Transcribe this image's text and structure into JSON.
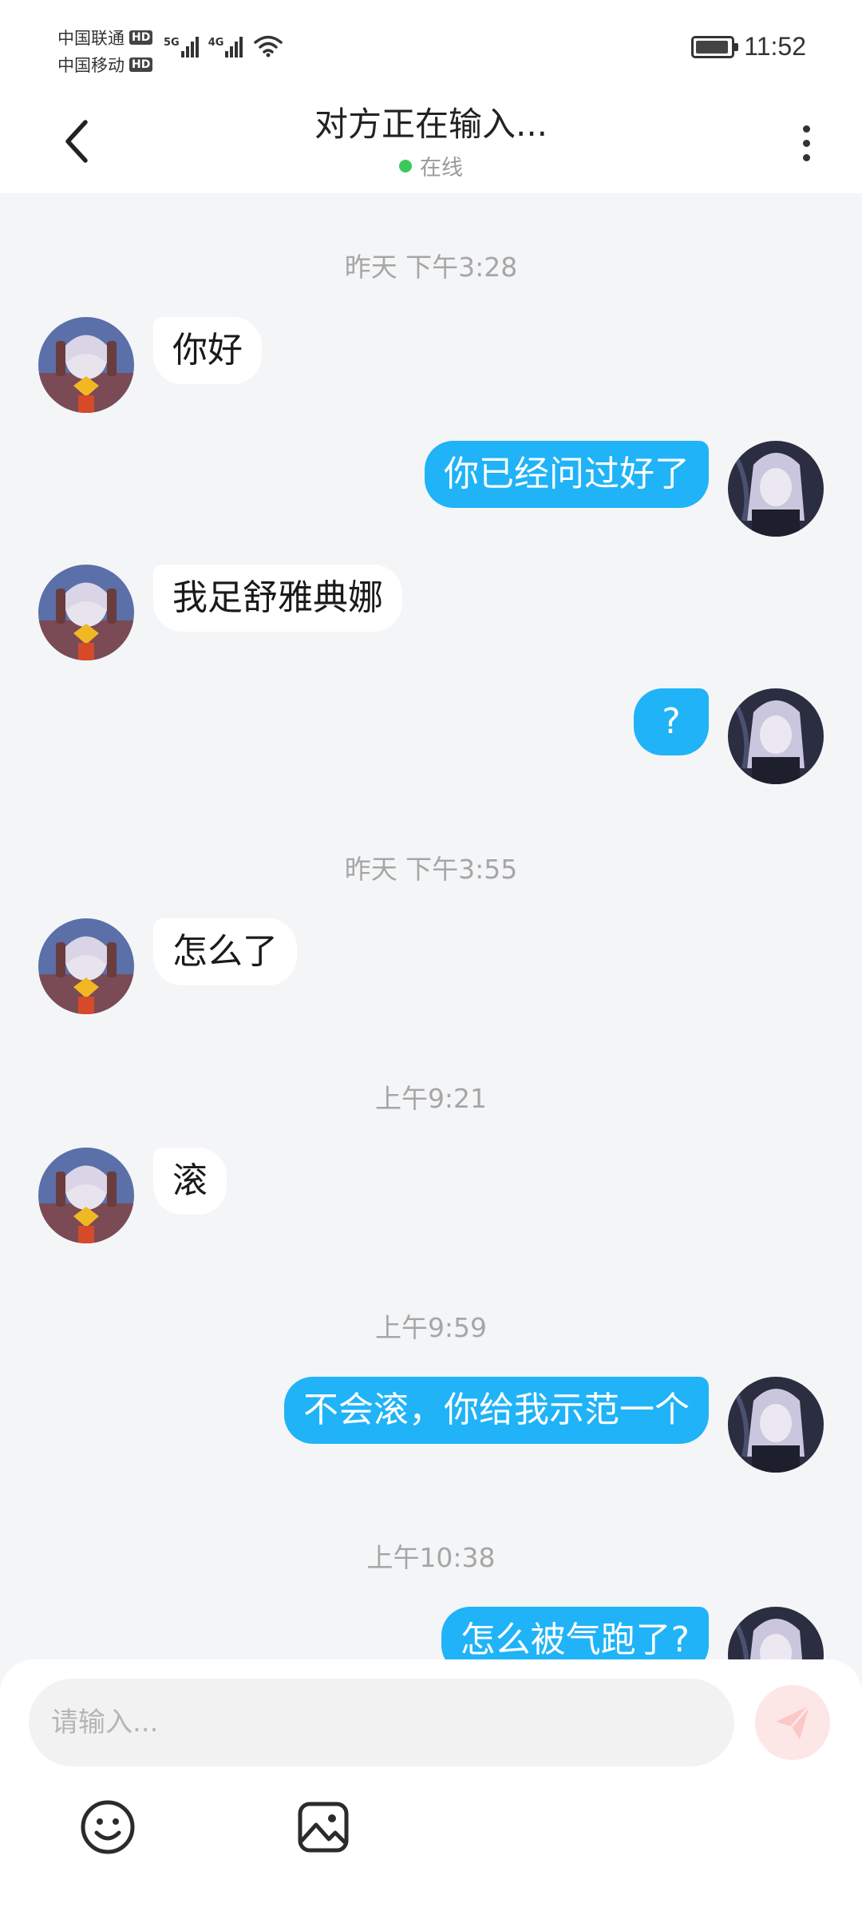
{
  "status_bar": {
    "carrier_1": "中国联通",
    "carrier_2": "中国移动",
    "hd_badge": "HD",
    "net_5g": "5G",
    "net_4g": "4G",
    "time": "11:52"
  },
  "header": {
    "title": "对方正在输入...",
    "presence": "在线",
    "presence_color": "#3cc95b"
  },
  "messages": [
    {
      "type": "time",
      "text": "昨天 下午3:28"
    },
    {
      "type": "in",
      "text": "你好"
    },
    {
      "type": "out",
      "text": "你已经问过好了"
    },
    {
      "type": "in",
      "text": "我足舒雅典娜"
    },
    {
      "type": "out",
      "text": "?"
    },
    {
      "type": "time",
      "text": "昨天 下午3:55"
    },
    {
      "type": "in",
      "text": "怎么了"
    },
    {
      "type": "time",
      "text": "上午9:21"
    },
    {
      "type": "in",
      "text": "滚"
    },
    {
      "type": "time",
      "text": "上午9:59"
    },
    {
      "type": "out",
      "text": "不会滚，你给我示范一个"
    },
    {
      "type": "time",
      "text": "上午10:38"
    },
    {
      "type": "out",
      "text": "怎么被气跑了?"
    }
  ],
  "composer": {
    "placeholder": "请输入...",
    "send_icon": "send-paper-plane-icon",
    "emoji_icon": "emoji-smile-icon",
    "image_icon": "image-picture-icon"
  },
  "colors": {
    "outgoing_bubble": "#20b3f7",
    "incoming_bubble": "#ffffff",
    "background": "#f4f5f7",
    "send_button": "#fde6e6"
  }
}
